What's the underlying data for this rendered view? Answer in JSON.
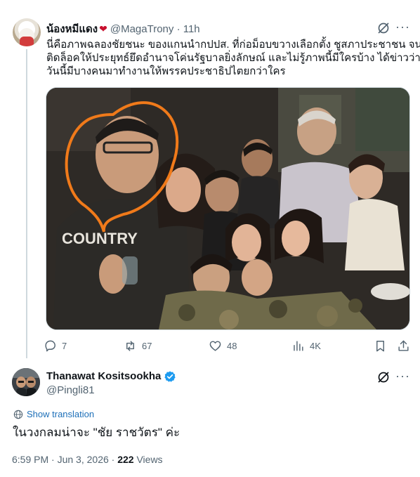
{
  "parent_tweet": {
    "display_name": "น้องหมีแดง",
    "handle": "@MagaTrony",
    "separator": "·",
    "time": "11h",
    "text_lines": [
      "นี่คือภาพฉลองชัยชนะ ของแกนนำกปปส. ที่ก่อม็อบขวางเลือกตั้ง ชูสภาประชาชน จน",
      "ติดล็อคให้ประยุทธ์ยึดอำนาจโค่นรัฐบาลยิ่งลักษณ์  และไม่รู้ภาพนี้มีใครบ้าง ได้ข่าวว่า",
      "วันนี้มีบางคนมาทำงานให้พรรคประชาธิปไตยกว่าใคร"
    ],
    "photo_text": "COUNTRY",
    "replies": "7",
    "reposts": "67",
    "likes": "48",
    "views": "4K"
  },
  "main_tweet": {
    "display_name": "Thanawat Kositsookha",
    "handle": "@Pingli81",
    "show_translation": "Show translation",
    "text": "ในวงกลมน่าจะ \"ชัย ราชวัตร\" ค่ะ",
    "time": "6:59 PM",
    "separator": "·",
    "date": "Jun 3, 2026",
    "separator2": "·",
    "views_count": "222",
    "views_label": "Views"
  },
  "colors": {
    "text_primary": "#0f1419",
    "text_secondary": "#536471",
    "link_blue": "#1d6fb8",
    "verified_blue": "#1d9bf0",
    "annotation_orange": "#f07a1a",
    "thread_line": "#cfd9de"
  }
}
